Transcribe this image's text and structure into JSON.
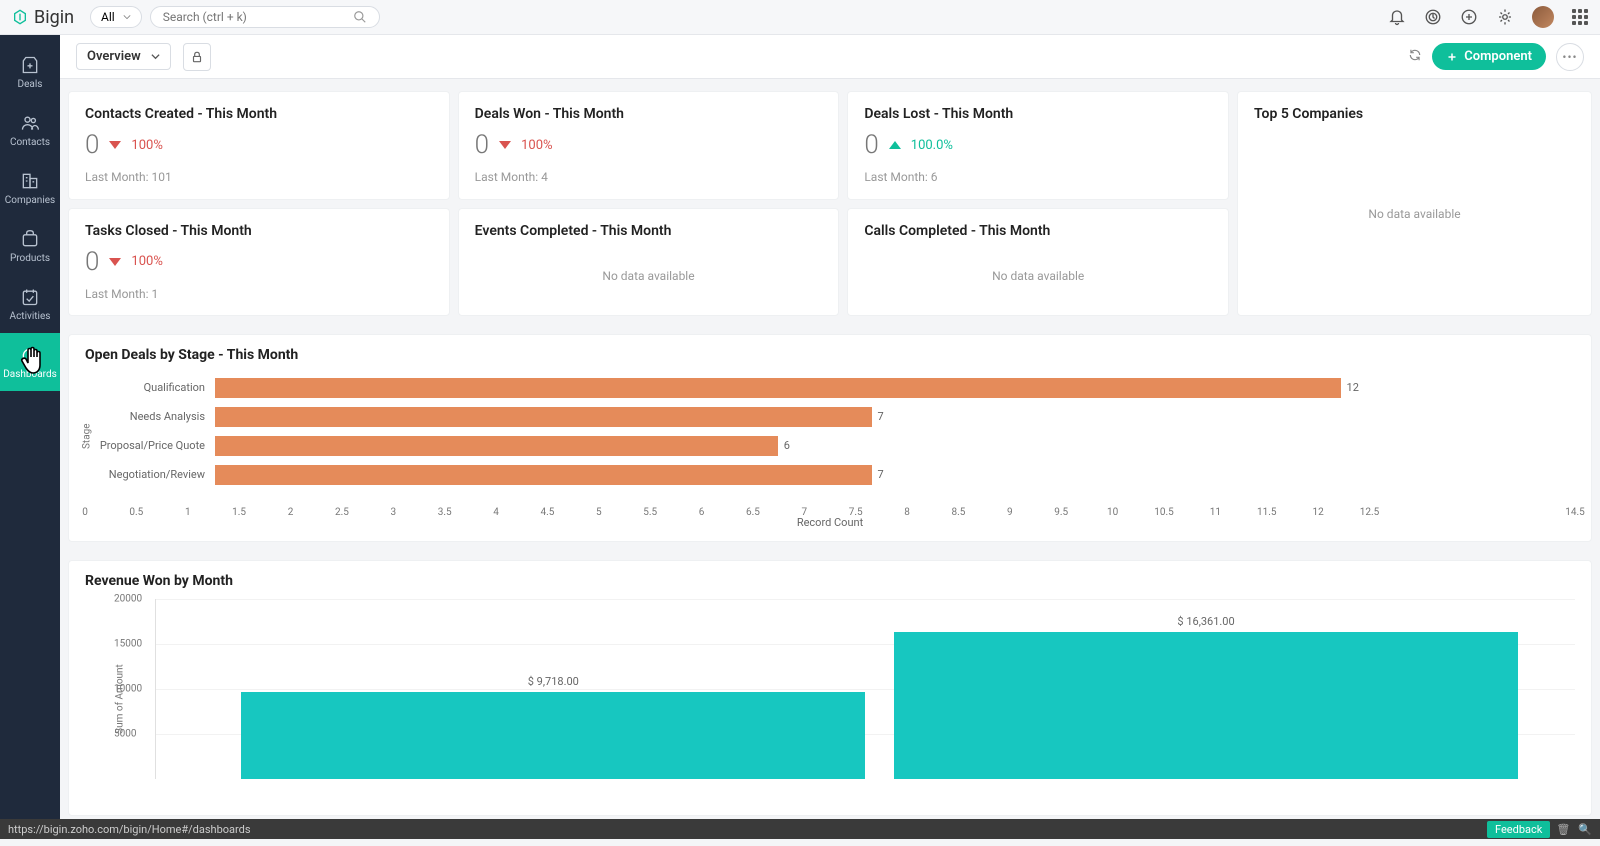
{
  "app": {
    "name": "Bigin",
    "scope": "All",
    "search_placeholder": "Search (ctrl + k)"
  },
  "sidebar": {
    "items": [
      {
        "label": "Deals"
      },
      {
        "label": "Contacts"
      },
      {
        "label": "Companies"
      },
      {
        "label": "Products"
      },
      {
        "label": "Activities"
      },
      {
        "label": "Dashboards"
      }
    ]
  },
  "subheader": {
    "view": "Overview",
    "component_btn": "Component"
  },
  "cards": {
    "contacts_created": {
      "title": "Contacts Created - This Month",
      "value": "0",
      "pct": "100%",
      "trend": "down",
      "last": "Last Month: 101"
    },
    "deals_won": {
      "title": "Deals Won - This Month",
      "value": "0",
      "pct": "100%",
      "trend": "down",
      "last": "Last Month: 4"
    },
    "deals_lost": {
      "title": "Deals Lost - This Month",
      "value": "0",
      "pct": "100.0%",
      "trend": "up",
      "last": "Last Month: 6"
    },
    "top5": {
      "title": "Top 5 Companies",
      "empty": "No data available"
    },
    "tasks_closed": {
      "title": "Tasks Closed - This Month",
      "value": "0",
      "pct": "100%",
      "trend": "down",
      "last": "Last Month: 1"
    },
    "events_completed": {
      "title": "Events Completed - This Month",
      "empty": "No data available"
    },
    "calls_completed": {
      "title": "Calls Completed - This Month",
      "empty": "No data available"
    }
  },
  "chart_data": [
    {
      "type": "bar",
      "orientation": "horizontal",
      "title": "Open Deals by Stage - This Month",
      "categories": [
        "Qualification",
        "Needs Analysis",
        "Proposal/Price Quote",
        "Negotiation/Review"
      ],
      "values": [
        12,
        7,
        6,
        7
      ],
      "xlabel": "Record Count",
      "ylabel": "Stage",
      "xlim": [
        0,
        14.5
      ],
      "xticks": [
        0,
        0.5,
        1,
        1.5,
        2,
        2.5,
        3,
        3.5,
        4,
        4.5,
        5,
        5.5,
        6,
        6.5,
        7,
        7.5,
        8,
        8.5,
        9,
        9.5,
        10,
        10.5,
        11,
        11.5,
        12,
        12.5,
        14.5
      ],
      "color": "#e58b5a"
    },
    {
      "type": "bar",
      "orientation": "vertical",
      "title": "Revenue Won by Month",
      "categories": [
        "",
        ""
      ],
      "values": [
        9718.0,
        16361.0
      ],
      "value_labels": [
        "$ 9,718.00",
        "$ 16,361.00"
      ],
      "ylabel": "Sum of Amount",
      "ylim": [
        0,
        20000
      ],
      "yticks": [
        5000,
        10000,
        15000,
        20000
      ],
      "color": "#17c7c0"
    }
  ],
  "status": {
    "url": "https://bigin.zoho.com/bigin/Home#/dashboards",
    "feedback": "Feedback"
  }
}
